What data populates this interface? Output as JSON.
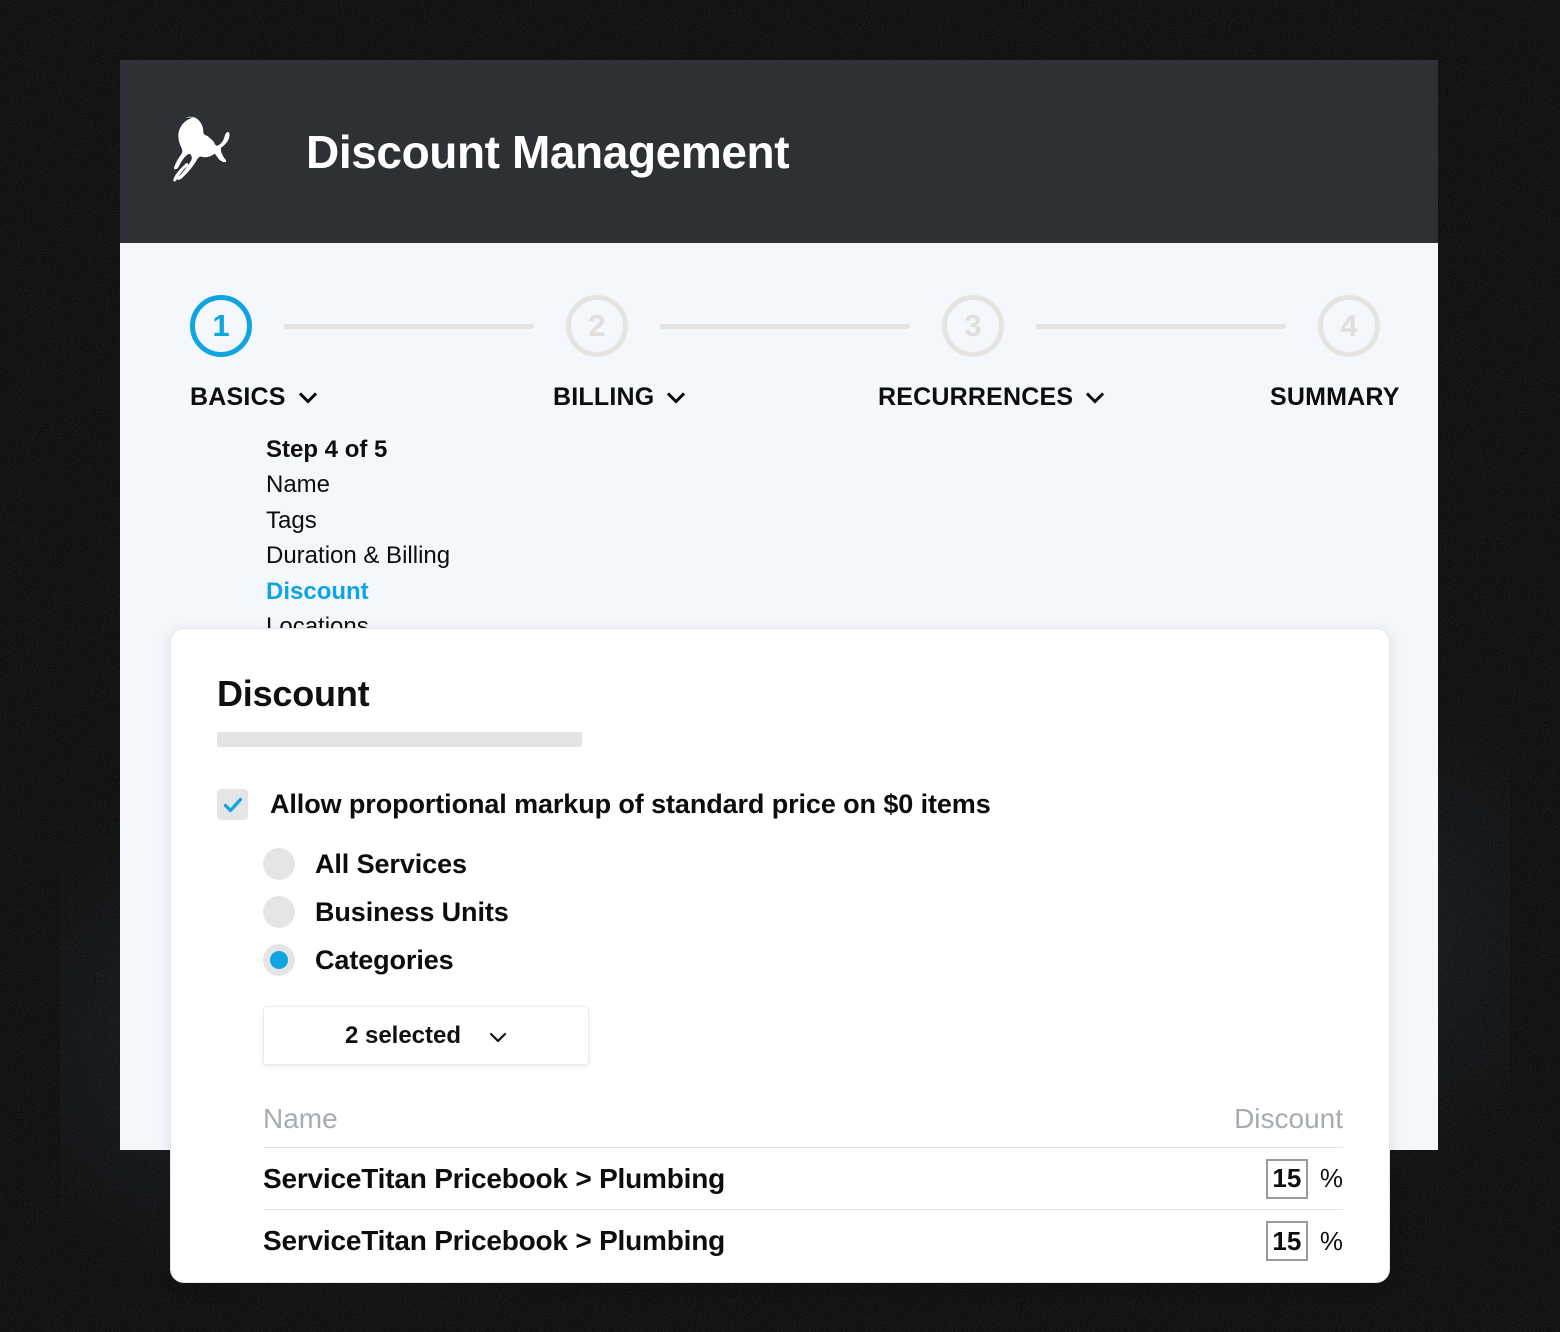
{
  "header": {
    "title": "Discount Management",
    "logo_icon": "servicetitan-titan-head-logo",
    "background_color": "#2d3035"
  },
  "theme": {
    "accent": "#0ea5e0",
    "panel_bg": "#f4f7fb",
    "muted": "#e6e4e1",
    "text": "#0d0d0d"
  },
  "stepper": {
    "steps": [
      {
        "number": "1",
        "label": "BASICS",
        "active": true,
        "has_chevron": true
      },
      {
        "number": "2",
        "label": "BILLING",
        "active": false,
        "has_chevron": true
      },
      {
        "number": "3",
        "label": "RECURRENCES",
        "active": false,
        "has_chevron": true
      },
      {
        "number": "4",
        "label": "SUMMARY",
        "active": false,
        "has_chevron": false
      }
    ]
  },
  "substeps": {
    "progress": "Step 4 of 5",
    "items": [
      {
        "label": "Name",
        "current": false
      },
      {
        "label": "Tags",
        "current": false
      },
      {
        "label": "Duration & Billing",
        "current": false
      },
      {
        "label": "Discount",
        "current": true
      },
      {
        "label": "Locations",
        "current": false
      }
    ]
  },
  "card": {
    "title": "Discount",
    "checkbox": {
      "label": "Allow proportional markup of standard price on $0 items",
      "checked": true
    },
    "radios": [
      {
        "label": "All Services",
        "selected": false
      },
      {
        "label": "Business Units",
        "selected": false
      },
      {
        "label": "Categories",
        "selected": true
      }
    ],
    "dropdown": {
      "value": "2 selected",
      "icon": "chevron-down-icon"
    },
    "table": {
      "columns": [
        "Name",
        "Discount"
      ],
      "rows": [
        {
          "name": "ServiceTitan Pricebook > Plumbing",
          "discount": "15",
          "unit": "%"
        },
        {
          "name": "ServiceTitan Pricebook > Plumbing",
          "discount": "15",
          "unit": "%"
        }
      ]
    }
  }
}
